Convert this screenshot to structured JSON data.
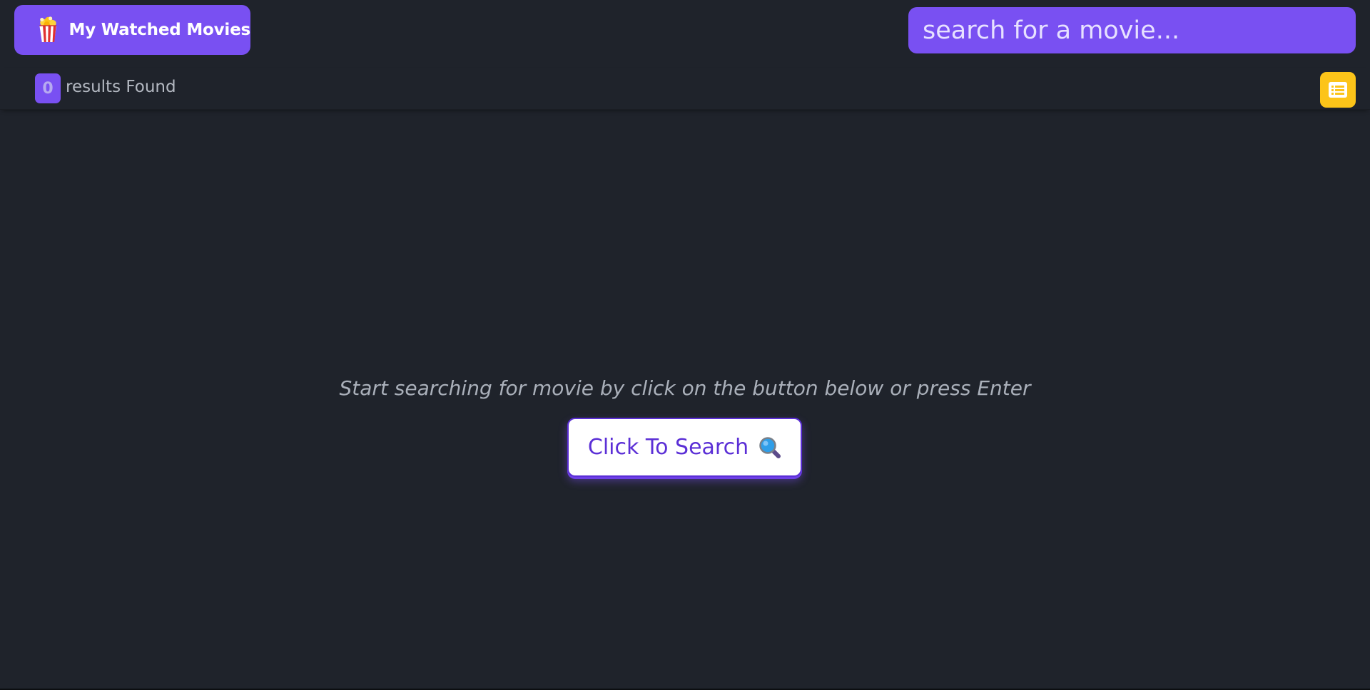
{
  "header": {
    "title": "My Watched Movies",
    "logo_icon": "popcorn-icon",
    "search": {
      "placeholder": "search for a movie...",
      "value": ""
    }
  },
  "results": {
    "count": "0",
    "label": "results Found",
    "list_toggle_icon": "list-icon"
  },
  "main": {
    "hint": "Start searching for movie by click on the button below or press Enter",
    "search_button_label": "Click To Search",
    "search_button_icon": "magnifier-icon"
  },
  "colors": {
    "background": "#1f232b",
    "accent": "#7950f2",
    "list_button": "#fcc419",
    "search_button_text": "#5b2fd6"
  }
}
